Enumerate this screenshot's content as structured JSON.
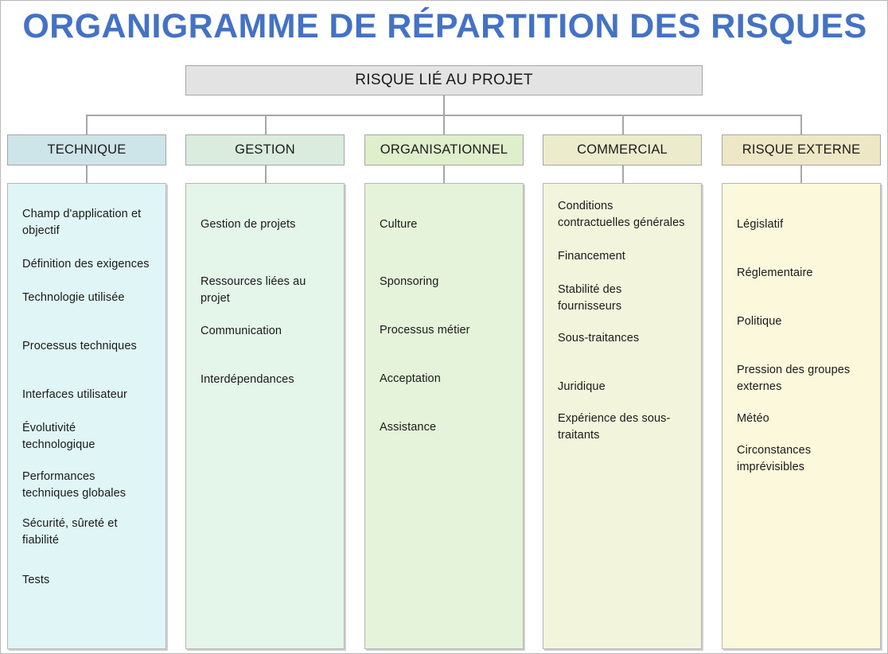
{
  "title": "ORGANIGRAMME DE RÉPARTITION DES RISQUES",
  "title_color": "#4472c4",
  "root": {
    "label": "RISQUE LIÉ AU PROJET",
    "fill": "#e3e3e3",
    "border": "#a6a6a6"
  },
  "connector_color": "#a6a6a6",
  "columns": [
    {
      "header": "TECHNIQUE",
      "header_fill": "#cde4e9",
      "body_fill": "#e0f5f5",
      "items": [
        "Champ d'application et objectif",
        "Définition des exigences",
        "Technologie utilisée",
        "Processus techniques",
        "Interfaces utilisateur",
        "Évolutivité technologique",
        "Performances techniques globales",
        "Sécurité, sûreté et fiabilité",
        "Tests"
      ]
    },
    {
      "header": "GESTION",
      "header_fill": "#d9ecdd",
      "body_fill": "#e4f5e9",
      "items": [
        "Gestion de projets",
        "Ressources liées au projet",
        "Communication",
        "Interdépendances"
      ]
    },
    {
      "header": "ORGANISATIONNEL",
      "header_fill": "#dfeecb",
      "body_fill": "#e4f3d9",
      "items": [
        "Culture",
        "Sponsoring",
        "Processus métier",
        "Acceptation",
        "Assistance"
      ]
    },
    {
      "header": "COMMERCIAL",
      "header_fill": "#ececcd",
      "body_fill": "#f2f5dc",
      "items": [
        "Conditions contractuelles générales",
        "Financement",
        "Stabilité des fournisseurs",
        "Sous-traitances",
        "Juridique",
        "Expérience des sous-traitants"
      ]
    },
    {
      "header": "RISQUE EXTERNE",
      "header_fill": "#eee7c5",
      "body_fill": "#fbf8dc",
      "items": [
        "Législatif",
        "Réglementaire",
        "Politique",
        "Pression des groupes externes",
        "Météo",
        "Circonstances imprévisibles"
      ]
    }
  ]
}
